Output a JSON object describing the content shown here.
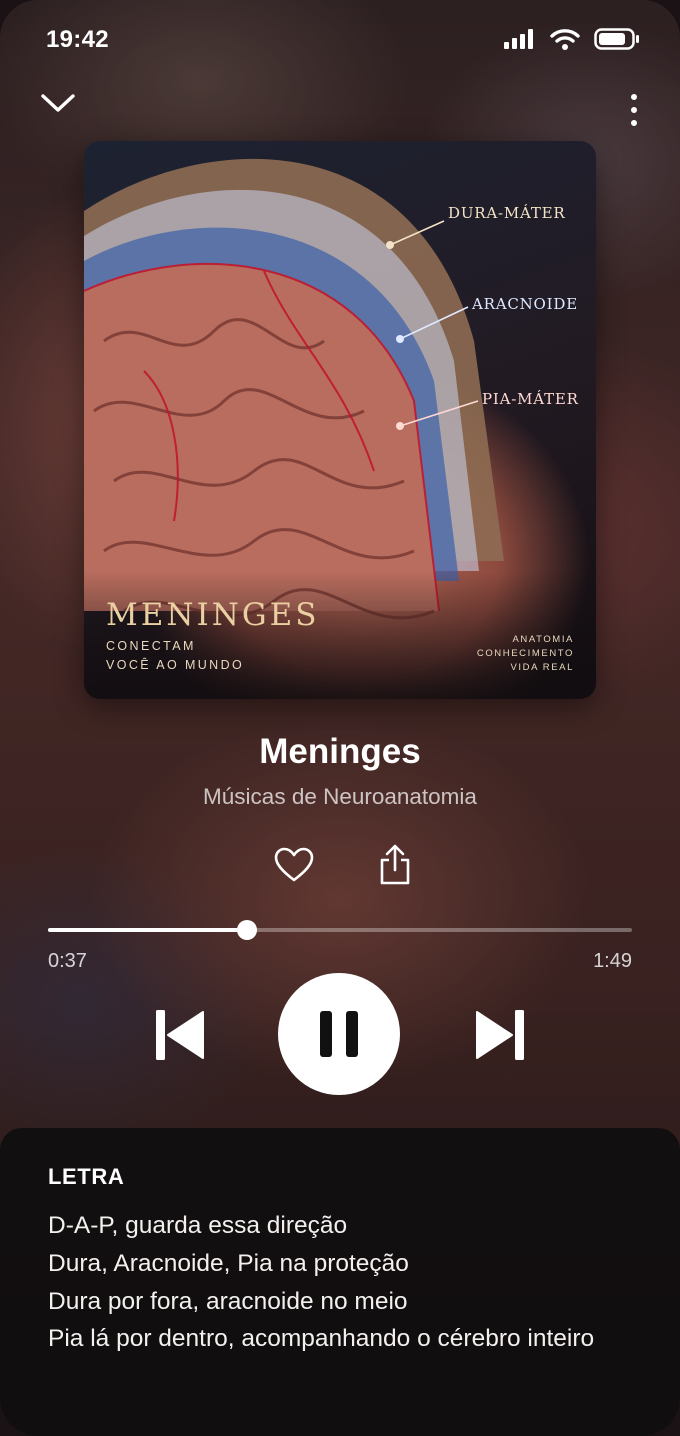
{
  "status_bar": {
    "time": "19:42"
  },
  "album_art": {
    "labels": [
      {
        "text": "DURA-MÁTER",
        "color": "#f3e3c6"
      },
      {
        "text": "ARACNOIDE",
        "color": "#dfe9ff"
      },
      {
        "text": "PIA-MÁTER",
        "color": "#ffd9d4"
      }
    ],
    "title": "MENINGES",
    "subtitle_lines": [
      "CONECTAM",
      "VOCÊ AO MUNDO"
    ],
    "tagline_lines": [
      "ANATOMIA",
      "CONHECIMENTO",
      "VIDA REAL"
    ]
  },
  "track": {
    "title": "Meninges",
    "artist": "Músicas de Neuroanatomia"
  },
  "playback": {
    "elapsed": "0:37",
    "total": "1:49",
    "progress_fraction": 0.34
  },
  "lyrics": {
    "heading": "LETRA",
    "lines": [
      "D-A-P, guarda essa direção",
      "Dura, Aracnoide, Pia na proteção",
      "Dura por fora, aracnoide no meio",
      "Pia lá por dentro, acompanhando o cérebro inteiro"
    ]
  },
  "icons": {
    "collapse": "chevron-down-icon",
    "menu": "more-vertical-icon",
    "like": "heart-icon",
    "share": "share-icon",
    "previous": "skip-previous-icon",
    "pause": "pause-icon",
    "next": "skip-next-icon"
  },
  "colors": {
    "accent": "#ffffff",
    "lyrics_panel": "#100e10",
    "art_title": "#e9cfa1"
  }
}
